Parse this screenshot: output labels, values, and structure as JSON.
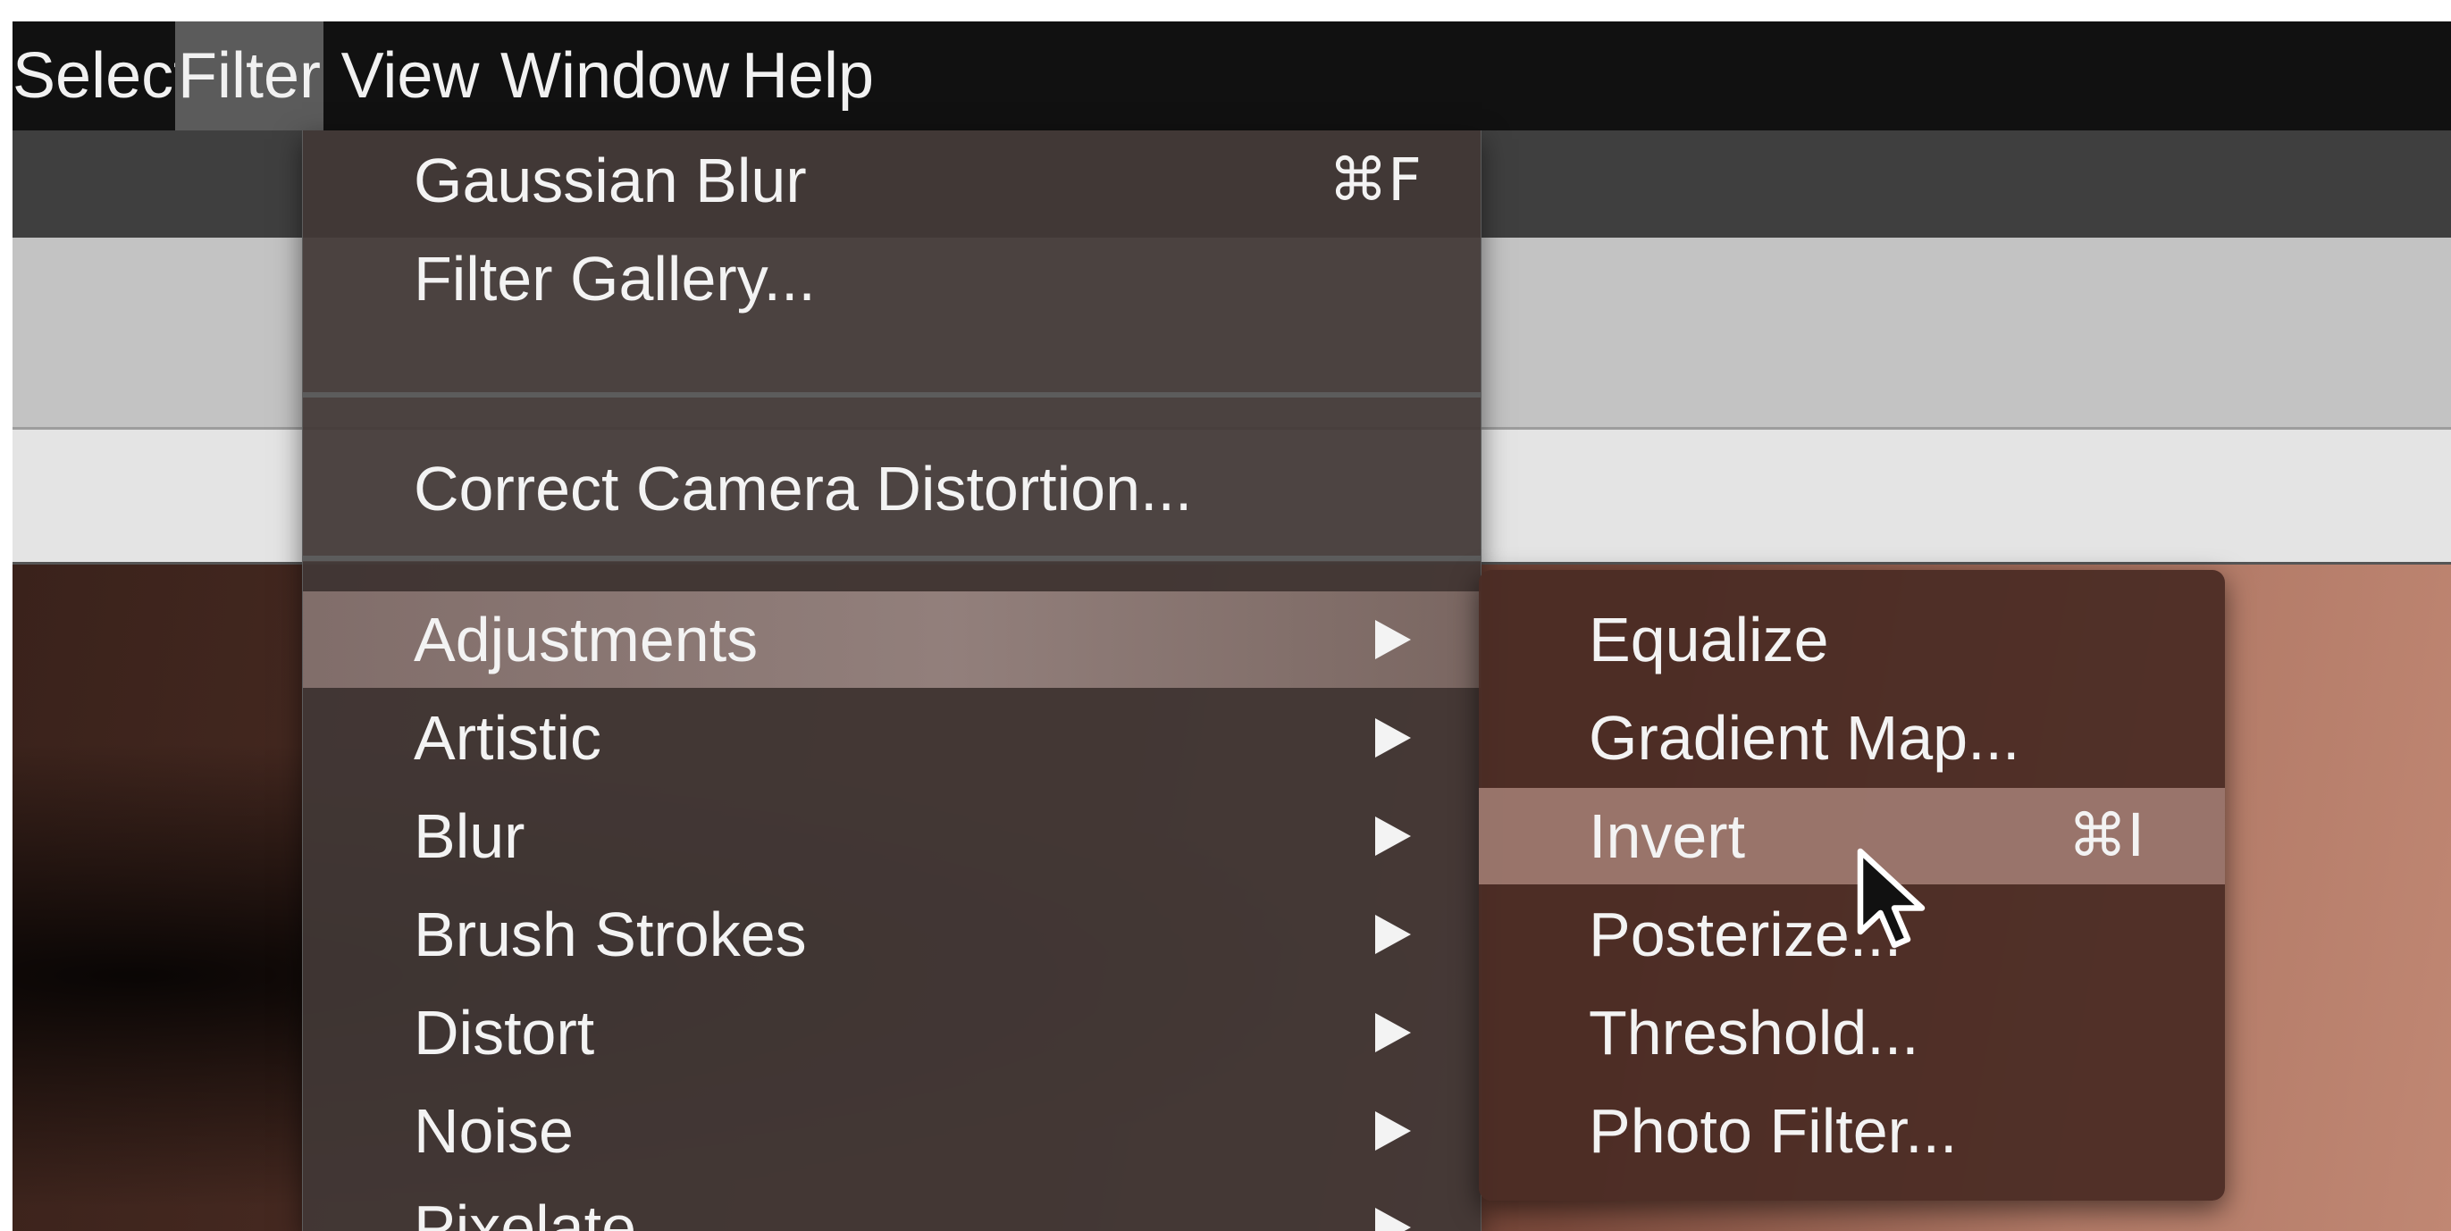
{
  "menubar": {
    "items": [
      {
        "label": "Select"
      },
      {
        "label": "Filter"
      },
      {
        "label": "View"
      },
      {
        "label": "Window"
      },
      {
        "label": "Help"
      }
    ],
    "active": "Filter"
  },
  "filter_menu": {
    "group1": [
      {
        "label": "Gaussian Blur",
        "shortcut": "⌘F"
      },
      {
        "label": "Filter Gallery..."
      }
    ],
    "group2": [
      {
        "label": "Correct Camera Distortion..."
      }
    ],
    "group3": [
      {
        "label": "Adjustments",
        "submenu": true,
        "highlighted": true
      },
      {
        "label": "Artistic",
        "submenu": true
      },
      {
        "label": "Blur",
        "submenu": true
      },
      {
        "label": "Brush Strokes",
        "submenu": true
      },
      {
        "label": "Distort",
        "submenu": true
      },
      {
        "label": "Noise",
        "submenu": true
      },
      {
        "label": "Pixelate",
        "submenu": true
      }
    ]
  },
  "adjustments_submenu": {
    "items": [
      {
        "label": "Equalize"
      },
      {
        "label": "Gradient Map..."
      },
      {
        "label": "Invert",
        "shortcut": "⌘I",
        "highlighted": true
      },
      {
        "label": "Posterize..."
      },
      {
        "label": "Threshold..."
      },
      {
        "label": "Photo Filter..."
      }
    ]
  },
  "icons": {
    "submenu_arrow": "triangle-right-icon",
    "cursor": "mouse-pointer-icon"
  },
  "colors": {
    "menubar_bg": "#111111",
    "menu_bg": "#423836",
    "menu_highlight": "#96807c",
    "submenu_bg": "#4a2c24",
    "submenu_highlight": "#aa847a",
    "menu_text": "#f3f3f3"
  }
}
